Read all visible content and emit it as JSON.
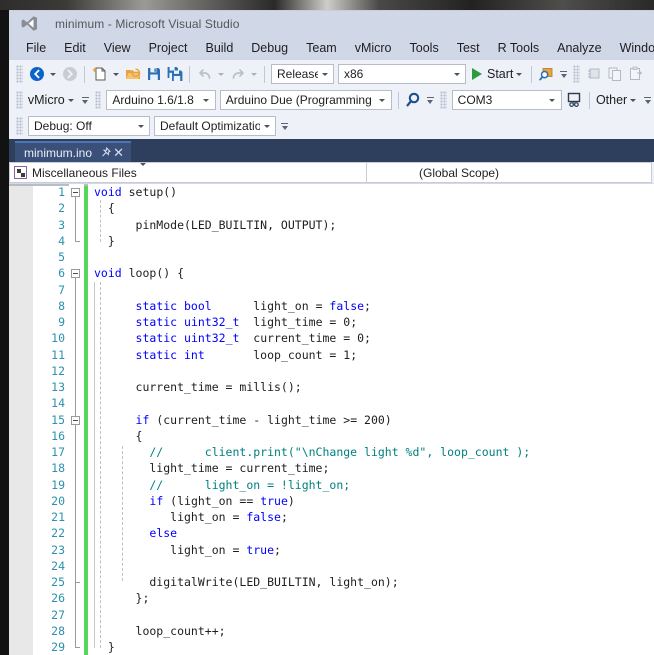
{
  "window": {
    "title": "minimum - Microsoft Visual Studio",
    "logo_icon": "visual-studio-logo-icon"
  },
  "menubar": {
    "items": [
      {
        "label": "File"
      },
      {
        "label": "Edit"
      },
      {
        "label": "View"
      },
      {
        "label": "Project"
      },
      {
        "label": "Build"
      },
      {
        "label": "Debug"
      },
      {
        "label": "Team"
      },
      {
        "label": "vMicro"
      },
      {
        "label": "Tools"
      },
      {
        "label": "Test"
      },
      {
        "label": "R Tools"
      },
      {
        "label": "Analyze"
      },
      {
        "label": "Window"
      }
    ]
  },
  "toolbar_standard": {
    "navigate_back_icon": "navigate-back-icon",
    "navigate_forward_icon": "navigate-forward-icon",
    "new_item_icon": "new-item-icon",
    "open_file_icon": "open-folder-icon",
    "save_icon": "save-icon",
    "save_all_icon": "save-all-icon",
    "undo_icon": "undo-icon",
    "redo_icon": "redo-icon",
    "configuration": "Release",
    "platform": "x86",
    "start_label": "Start",
    "find_icon": "find-icon",
    "snippet_icon_1": "comment-block-icon",
    "snippet_icon_2": "copy-icon",
    "snippet_icon_3": "paste-icon"
  },
  "toolbar_vmicro": {
    "menu_label": "vMicro",
    "ide_version": "Arduino 1.6/1.8",
    "board": "Arduino Due (Programming P‹",
    "search_icon": "magnifier-icon",
    "serial_port": "COM3",
    "monitor_icon": "serial-monitor-icon",
    "other_label": "Other"
  },
  "toolbar_debug": {
    "debug_mode": "Debug: Off",
    "optimization": "Default Optimizatio"
  },
  "document_tab": {
    "name": "minimum.ino",
    "pin_icon": "pin-icon",
    "close_icon": "close-icon"
  },
  "navbar": {
    "project_icon": "miscellaneous-files-icon",
    "project_scope": "Miscellaneous Files",
    "member_scope": "(Global Scope)"
  },
  "colors": {
    "accent": "#2d3f5c",
    "titlebar": "#d0d8e8",
    "keyword": "#0000ff",
    "type": "#2b91af",
    "comment": "#008080",
    "string": "#a31515",
    "change_bar": "#57d65d",
    "linenumber": "#2b91af",
    "start_green": "#2d9b3f"
  },
  "editor": {
    "line_count": 29,
    "line_numbers": [
      1,
      2,
      3,
      4,
      5,
      6,
      7,
      8,
      9,
      10,
      11,
      12,
      13,
      14,
      15,
      16,
      17,
      18,
      19,
      20,
      21,
      22,
      23,
      24,
      25,
      26,
      27,
      28,
      29
    ],
    "lines": [
      {
        "n": 1,
        "text": "void setup()",
        "tokens": [
          {
            "t": "void",
            "c": "kw"
          },
          {
            "t": " setup()",
            "c": "num"
          }
        ]
      },
      {
        "n": 2,
        "text": "{",
        "tokens": [
          {
            "t": "  {",
            "c": "num"
          }
        ]
      },
      {
        "n": 3,
        "text": "    pinMode(LED_BUILTIN, OUTPUT);",
        "tokens": [
          {
            "t": "      pinMode(LED_BUILTIN, OUTPUT);",
            "c": "num"
          }
        ]
      },
      {
        "n": 4,
        "text": "}",
        "tokens": [
          {
            "t": "  }",
            "c": "num"
          }
        ]
      },
      {
        "n": 5,
        "text": "",
        "tokens": []
      },
      {
        "n": 6,
        "text": "void loop() {",
        "tokens": [
          {
            "t": "void",
            "c": "kw"
          },
          {
            "t": " loop() {",
            "c": "num"
          }
        ]
      },
      {
        "n": 7,
        "text": "",
        "tokens": []
      },
      {
        "n": 8,
        "text": "    static bool      light_on = false;",
        "tokens": [
          {
            "t": "      ",
            "c": "num"
          },
          {
            "t": "static bool",
            "c": "kw"
          },
          {
            "t": "      light_on = ",
            "c": "num"
          },
          {
            "t": "false",
            "c": "kw"
          },
          {
            "t": ";",
            "c": "num"
          }
        ]
      },
      {
        "n": 9,
        "text": "    static uint32_t  light_time = 0;",
        "tokens": [
          {
            "t": "      ",
            "c": "num"
          },
          {
            "t": "static",
            "c": "kw"
          },
          {
            "t": " ",
            "c": "num"
          },
          {
            "t": "uint32_t",
            "c": "kw"
          },
          {
            "t": "  light_time = 0;",
            "c": "num"
          }
        ]
      },
      {
        "n": 10,
        "text": "    static uint32_t  current_time = 0;",
        "tokens": [
          {
            "t": "      ",
            "c": "num"
          },
          {
            "t": "static",
            "c": "kw"
          },
          {
            "t": " ",
            "c": "num"
          },
          {
            "t": "uint32_t",
            "c": "kw"
          },
          {
            "t": "  current_time = 0;",
            "c": "num"
          }
        ]
      },
      {
        "n": 11,
        "text": "    static int       loop_count = 1;",
        "tokens": [
          {
            "t": "      ",
            "c": "num"
          },
          {
            "t": "static int",
            "c": "kw"
          },
          {
            "t": "       loop_count = 1;",
            "c": "num"
          }
        ]
      },
      {
        "n": 12,
        "text": "",
        "tokens": []
      },
      {
        "n": 13,
        "text": "    current_time = millis();",
        "tokens": [
          {
            "t": "      current_time = millis();",
            "c": "num"
          }
        ]
      },
      {
        "n": 14,
        "text": "",
        "tokens": []
      },
      {
        "n": 15,
        "text": "    if (current_time - light_time >= 200)",
        "tokens": [
          {
            "t": "      ",
            "c": "num"
          },
          {
            "t": "if",
            "c": "kw"
          },
          {
            "t": " (current_time - light_time >= 200)",
            "c": "num"
          }
        ]
      },
      {
        "n": 16,
        "text": "    {",
        "tokens": [
          {
            "t": "      {",
            "c": "num"
          }
        ]
      },
      {
        "n": 17,
        "text": "      //      client.print(\"\\nChange light %d\", loop_count );",
        "tokens": [
          {
            "t": "        //      client.print(\"\\nChange light %d\", loop_count );",
            "c": "cmt"
          }
        ]
      },
      {
        "n": 18,
        "text": "      light_time = current_time;",
        "tokens": [
          {
            "t": "        light_time = current_time;",
            "c": "num"
          }
        ]
      },
      {
        "n": 19,
        "text": "      //      light_on = !light_on;",
        "tokens": [
          {
            "t": "        //      light_on = !light_on;",
            "c": "cmt"
          }
        ]
      },
      {
        "n": 20,
        "text": "      if (light_on == true)",
        "tokens": [
          {
            "t": "        ",
            "c": "num"
          },
          {
            "t": "if",
            "c": "kw"
          },
          {
            "t": " (light_on == ",
            "c": "num"
          },
          {
            "t": "true",
            "c": "kw"
          },
          {
            "t": ")",
            "c": "num"
          }
        ]
      },
      {
        "n": 21,
        "text": "         light_on = false;",
        "tokens": [
          {
            "t": "           light_on = ",
            "c": "num"
          },
          {
            "t": "false",
            "c": "kw"
          },
          {
            "t": ";",
            "c": "num"
          }
        ]
      },
      {
        "n": 22,
        "text": "      else",
        "tokens": [
          {
            "t": "        ",
            "c": "num"
          },
          {
            "t": "else",
            "c": "kw"
          }
        ]
      },
      {
        "n": 23,
        "text": "         light_on = true;",
        "tokens": [
          {
            "t": "           light_on = ",
            "c": "num"
          },
          {
            "t": "true",
            "c": "kw"
          },
          {
            "t": ";",
            "c": "num"
          }
        ]
      },
      {
        "n": 24,
        "text": "",
        "tokens": []
      },
      {
        "n": 25,
        "text": "      digitalWrite(LED_BUILTIN, light_on);",
        "tokens": [
          {
            "t": "        digitalWrite(LED_BUILTIN, light_on);",
            "c": "num"
          }
        ]
      },
      {
        "n": 26,
        "text": "    };",
        "tokens": [
          {
            "t": "      };",
            "c": "num"
          }
        ]
      },
      {
        "n": 27,
        "text": "",
        "tokens": []
      },
      {
        "n": 28,
        "text": "    loop_count++;",
        "tokens": [
          {
            "t": "      loop_count++;",
            "c": "num"
          }
        ]
      },
      {
        "n": 29,
        "text": "}",
        "tokens": [
          {
            "t": "  }",
            "c": "num"
          }
        ]
      }
    ]
  }
}
